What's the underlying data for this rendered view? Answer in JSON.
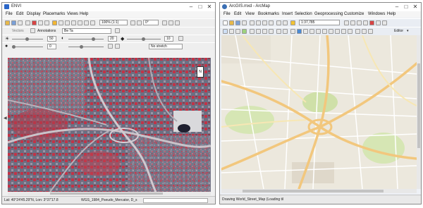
{
  "envi": {
    "title": "ENVI",
    "menu": [
      "File",
      "Edit",
      "Display",
      "Placemarks",
      "Views",
      "Help"
    ],
    "zoom": "100% (1:1)",
    "rotation": "0°",
    "vectors_label": "Vectors",
    "annotations_label": "Annotations",
    "layer_value": "Be Ta",
    "brightness": "50",
    "contrast": "20",
    "sharpen": "10",
    "transparency": "0",
    "stretch": "No stretch",
    "status_coords": "Lat: 40°24'45.29\"N, Lon: 3°37'17.8",
    "status_proj": "WGS_1984_Pseudo_Mercator, D_s"
  },
  "arcmap": {
    "title": "ArcGIS.mxd - ArcMap",
    "menu": [
      "File",
      "Edit",
      "View",
      "Bookmarks",
      "Insert",
      "Selection",
      "Geoprocessing",
      "Customize",
      "Windows",
      "Help"
    ],
    "scale": "1:37,785",
    "editor_label": "Editor",
    "status": "Drawing World_Street_Map (Loading til"
  },
  "colors": {
    "vegetation": "#c8283c",
    "urban": "#6b6e80",
    "road": "#f2c77d",
    "basemap": "#ece8dd",
    "green": "#cfe0a8"
  }
}
